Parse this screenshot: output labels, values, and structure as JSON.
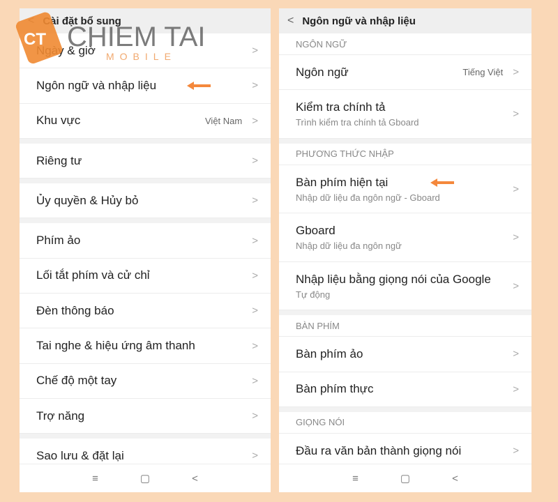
{
  "left": {
    "title": "Cài đặt bổ sung",
    "groups": [
      [
        {
          "label": "Ngày & giờ"
        },
        {
          "label": "Ngôn ngữ và nhập liệu",
          "arrow": true
        },
        {
          "label": "Khu vực",
          "value": "Việt Nam"
        }
      ],
      [
        {
          "label": "Riêng tư"
        }
      ],
      [
        {
          "label": "Ủy quyền & Hủy bỏ"
        }
      ],
      [
        {
          "label": "Phím ảo"
        },
        {
          "label": "Lối tắt phím và cử chỉ"
        },
        {
          "label": "Đèn thông báo"
        },
        {
          "label": "Tai nghe & hiệu ứng âm thanh"
        },
        {
          "label": "Chế độ một tay"
        },
        {
          "label": "Trợ năng"
        }
      ],
      [
        {
          "label": "Sao lưu & đặt lại"
        }
      ]
    ]
  },
  "right": {
    "title": "Ngôn ngữ và nhập liệu",
    "sections": [
      {
        "header": "NGÔN NGỮ",
        "items": [
          {
            "label": "Ngôn ngữ",
            "value": "Tiếng Việt"
          },
          {
            "label": "Kiểm tra chính tả",
            "sub": "Trình kiểm tra chính tả Gboard"
          }
        ]
      },
      {
        "header": "PHƯƠNG THỨC NHẬP",
        "items": [
          {
            "label": "Bàn phím hiện tại",
            "sub": "Nhập dữ liệu đa ngôn ngữ - Gboard",
            "arrow": true
          },
          {
            "label": "Gboard",
            "sub": "Nhập dữ liệu đa ngôn ngữ"
          },
          {
            "label": "Nhập liệu bằng giọng nói của Google",
            "sub": "Tự động"
          }
        ]
      },
      {
        "header": "BÀN PHÍM",
        "items": [
          {
            "label": "Bàn phím ảo"
          },
          {
            "label": "Bàn phím thực"
          }
        ]
      },
      {
        "header": "GIỌNG NÓI",
        "items": [
          {
            "label": "Đầu ra văn bản thành giọng nói"
          }
        ]
      }
    ]
  },
  "watermark": {
    "badge": "CT",
    "name": "CHIEM TAI",
    "tag": "MOBILE"
  },
  "colors": {
    "accent": "#f4883c",
    "background": "#fad8b7"
  },
  "nav": {
    "menu": "≡",
    "home": "▢",
    "back": "<"
  }
}
